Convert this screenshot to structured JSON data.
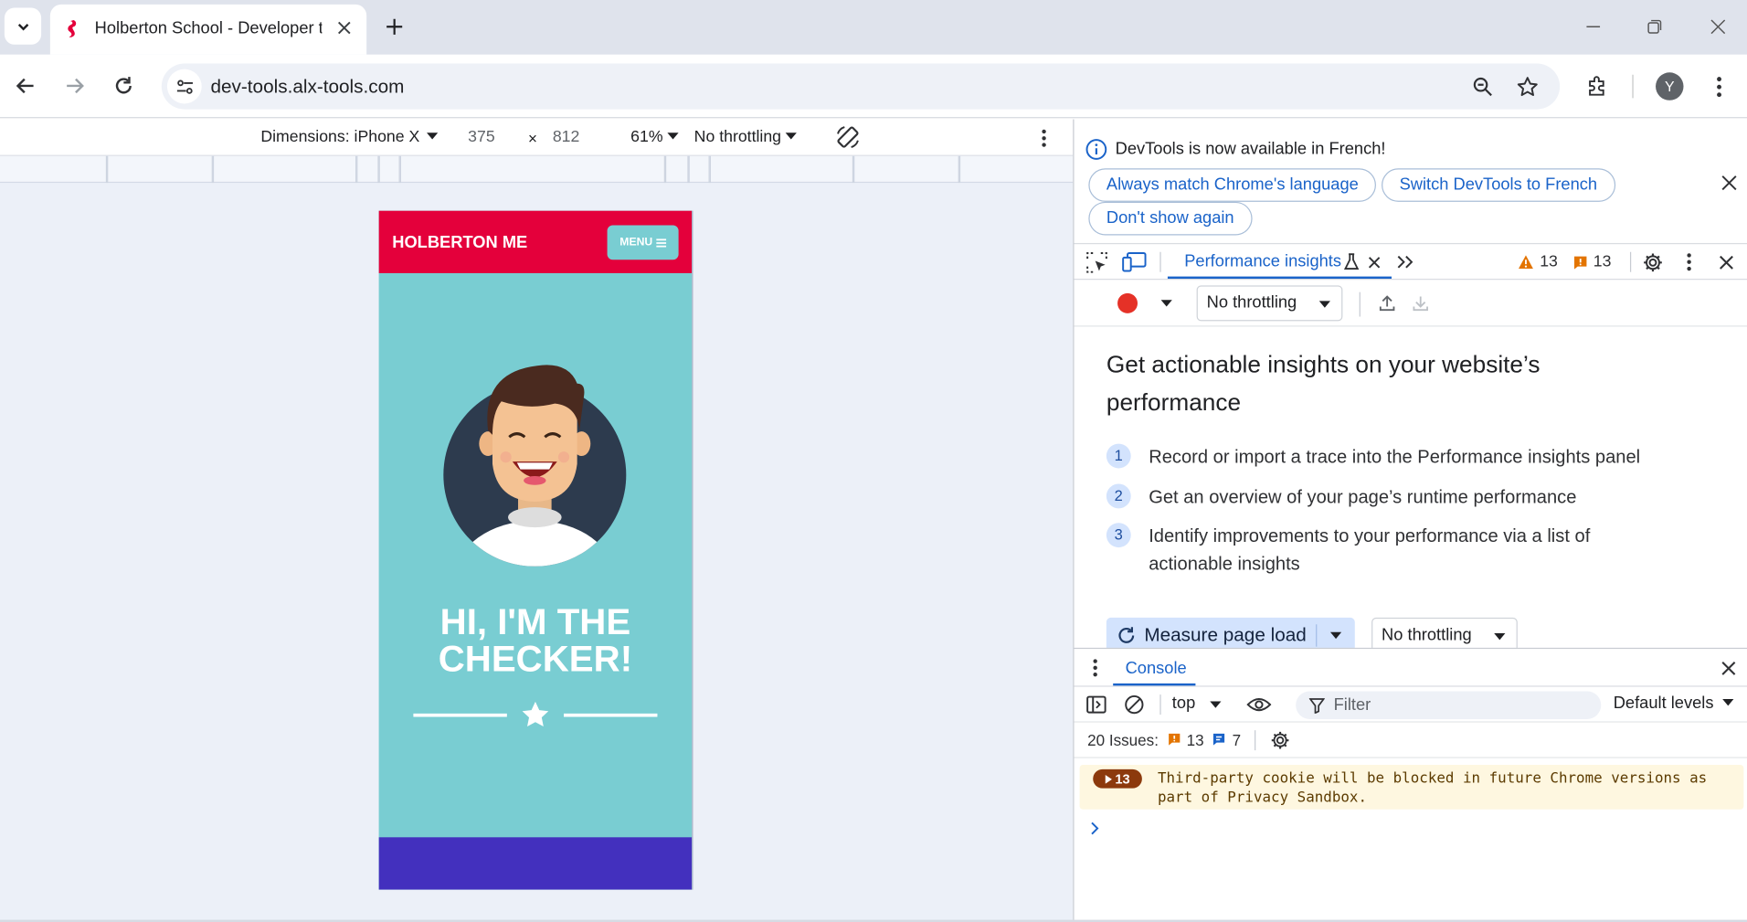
{
  "browser": {
    "tab_title": "Holberton School - Developer t",
    "url": "dev-tools.alx-tools.com",
    "profile_initial": "Y"
  },
  "emulation": {
    "dimensions": "Dimensions: iPhone X",
    "width": "375",
    "x_sep": "×",
    "height": "812",
    "zoom": "61%",
    "throttling": "No throttling"
  },
  "site": {
    "brand": "HOLBERTON ME",
    "menu": "MENU",
    "hero_line1": "HI, I'M THE",
    "hero_line2": "CHECKER!",
    "colors": {
      "header": "#e4003b",
      "background": "#79cdd2",
      "footer": "#4330be"
    }
  },
  "devtools": {
    "infobar": {
      "message": "DevTools is now available in French!",
      "btn_match": "Always match Chrome's language",
      "btn_switch": "Switch DevTools to French",
      "btn_dont_show": "Don't show again"
    },
    "panel_tab": "Performance insights",
    "warning_count": "13",
    "error_count": "13",
    "perf_throttling": "No throttling",
    "heading": "Get actionable insights on your website’s performance",
    "steps": [
      {
        "num": "1",
        "text": "Record or import a trace into the Performance insights panel"
      },
      {
        "num": "2",
        "text": "Get an overview of your page’s runtime performance"
      },
      {
        "num": "3",
        "text": "Identify improvements to your performance via a list of actionable insights"
      }
    ],
    "measure_button": "Measure page load",
    "measure_throttling": "No throttling",
    "console": {
      "tab": "Console",
      "context": "top",
      "filter_placeholder": "Filter",
      "levels": "Default levels",
      "issues_label": "20 Issues:",
      "issues_warn": "13",
      "issues_info": "7",
      "message_count": "13",
      "message_text": "Third-party cookie will be blocked in future Chrome versions as part of Privacy Sandbox."
    }
  }
}
